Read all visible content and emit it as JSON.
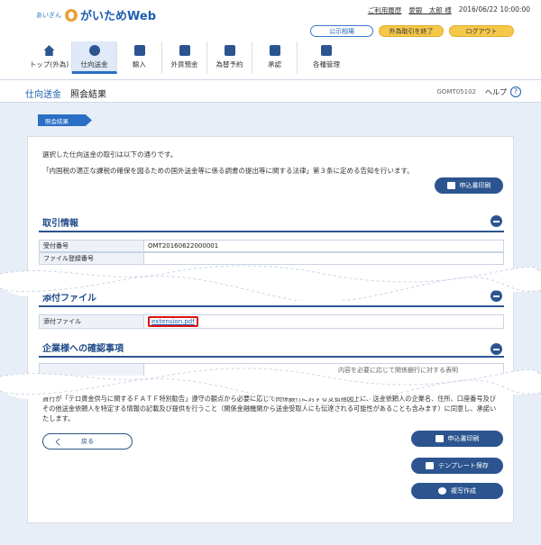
{
  "header": {
    "logo_small": "あいぎん",
    "logo_main": "がいためWeb",
    "history_link": "ご利用履歴",
    "user_name": "愛銀　太郎 様",
    "datetime": "2016/06/22 10:00:00",
    "rates_button": "公示相場",
    "end_button": "外為取引を終了",
    "logout_button": "ログアウト"
  },
  "nav": {
    "items": [
      {
        "label": "トップ(外為)",
        "icon": "home-icon"
      },
      {
        "label": "仕向送金",
        "icon": "remittance-icon"
      },
      {
        "label": "輸入",
        "icon": "import-icon"
      },
      {
        "label": "外貨預金",
        "icon": "deposit-icon"
      },
      {
        "label": "為替予約",
        "icon": "forward-contract-icon"
      },
      {
        "label": "承認",
        "icon": "approval-icon"
      },
      {
        "label": "各種管理",
        "icon": "management-icon"
      }
    ],
    "active_index": 1
  },
  "page": {
    "crumb_section": "仕向送金",
    "crumb_title": "照会結果",
    "screen_id": "GOMT05102",
    "help_label": "ヘルプ",
    "help_glyph": "?",
    "step_label": "照会結果"
  },
  "content": {
    "intro_line1": "選択した仕向送金の取引は以下の通りです。",
    "intro_line2": "「内国税の適正な課税の確保を図るための国外送金等に係る調書の提出等に関する法律」第３条に定める告知を行います。",
    "print_button": "申込書印刷",
    "section_transaction": "取引情報",
    "rows": [
      {
        "label": "受付番号",
        "value": "OMT20160622000001"
      },
      {
        "label": "ファイル登録番号",
        "value": ""
      }
    ],
    "section_attachment": "添付ファイル",
    "attachment_label": "添付ファイル",
    "attachment_file": "extension.pdf",
    "section_confirm": "企業様への確認事項",
    "confirm_row_partial": "内容を必要に応じて関係銀行に対する表明",
    "notice": "貴行が「テロ資金供与に関するＦＡＴＦ特別勧告」遵守の観点から必要に応じて関係銀行に対する支払指図上に、送金依頼人の企業名、住所、口座番号及びその他送金依頼人を特定する情報の記載及び提供を行うこと（関係金融機関から送金受取人にも伝達される可能性があることも含みます）に同意し、承諾いたします。",
    "back_button": "戻る",
    "back_glyph": "く",
    "bottom_print_button": "申込書印刷",
    "template_save_button": "テンプレート保存",
    "copy_create_button": "複写作成"
  }
}
